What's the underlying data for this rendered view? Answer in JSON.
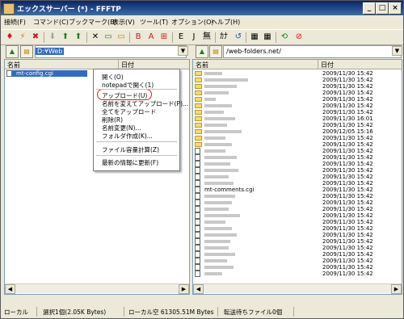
{
  "window": {
    "title": "エックスサーバー (*) - FFFTP",
    "minimize": "_",
    "maximize": "□",
    "close": "×"
  },
  "menu": [
    "接続(F)",
    "コマンド(C)",
    "ブックマーク(B)",
    "表示(V)",
    "ツール(T)",
    "オプション(O)",
    "ヘルプ(H)"
  ],
  "toolbar": {
    "icons": [
      "connect-icon",
      "quick-connect-icon",
      "disconnect-icon",
      "download-icon",
      "upload-icon",
      "mirror-upload-icon",
      "delete-icon",
      "rename-icon",
      "mkdir-icon",
      "binary-mode-icon",
      "ascii-mode-icon",
      "auto-mode-icon",
      "local-eucjp-icon",
      "local-jis-icon",
      "no-kana-icon",
      "kana-convert-icon",
      "refresh-icon",
      "list-view-icon",
      "detail-view-icon",
      "sync-folder-icon",
      "stop-icon"
    ],
    "labels": [
      "♦",
      "⚡",
      "✖",
      "⬇",
      "⬆",
      "⬆",
      "✕",
      "▭",
      "▭",
      "B",
      "A",
      "⊞",
      "E",
      "J",
      "無",
      "ｶﾅ",
      "↺",
      "▦",
      "▦",
      "⟲",
      "⊘"
    ]
  },
  "local": {
    "path": "D:¥Web",
    "col_name": "名前",
    "col_date": "日付",
    "files": [
      {
        "name": "mt-config.cgi",
        "type": "file"
      }
    ]
  },
  "remote": {
    "path": "/web-folders.net/",
    "col_name": "名前",
    "col_date": "日付",
    "entries": [
      {
        "name": "",
        "type": "folder",
        "date": "2009/11/30 15:42"
      },
      {
        "name": "",
        "type": "folder",
        "date": "2009/11/30 15:42"
      },
      {
        "name": "",
        "type": "folder",
        "date": "2009/11/30 15:42"
      },
      {
        "name": "",
        "type": "folder",
        "date": "2009/11/30 15:42"
      },
      {
        "name": "",
        "type": "folder",
        "date": "2009/11/30 15:42"
      },
      {
        "name": "",
        "type": "folder",
        "date": "2009/11/30 15:42"
      },
      {
        "name": "",
        "type": "folder",
        "date": "2009/11/30 15:42"
      },
      {
        "name": "",
        "type": "folder",
        "date": "2009/11/30 16:01"
      },
      {
        "name": "",
        "type": "folder",
        "date": "2009/11/30 15:42"
      },
      {
        "name": "",
        "type": "folder",
        "date": "2009/12/05 15:16"
      },
      {
        "name": "",
        "type": "folder",
        "date": "2009/11/30 15:42"
      },
      {
        "name": "",
        "type": "folder",
        "date": "2009/11/30 15:42"
      },
      {
        "name": "",
        "type": "file",
        "date": "2009/11/30 15:42"
      },
      {
        "name": "",
        "type": "file",
        "date": "2009/11/30 15:42"
      },
      {
        "name": "",
        "type": "file",
        "date": "2009/11/30 15:42"
      },
      {
        "name": "",
        "type": "file",
        "date": "2009/11/30 15:42"
      },
      {
        "name": "",
        "type": "file",
        "date": "2009/11/30 15:42"
      },
      {
        "name": "",
        "type": "file",
        "date": "2009/11/30 15:42"
      },
      {
        "name": "mt-comments.cgi",
        "type": "file",
        "date": "2009/11/30 15:42"
      },
      {
        "name": "",
        "type": "file",
        "date": "2009/11/30 15:42"
      },
      {
        "name": "",
        "type": "file",
        "date": "2009/11/30 15:42"
      },
      {
        "name": "",
        "type": "file",
        "date": "2009/11/30 15:42"
      },
      {
        "name": "",
        "type": "file",
        "date": "2009/11/30 15:42"
      },
      {
        "name": "",
        "type": "file",
        "date": "2009/11/30 15:42"
      },
      {
        "name": "",
        "type": "file",
        "date": "2009/11/30 15:42"
      },
      {
        "name": "",
        "type": "file",
        "date": "2009/11/30 15:42"
      },
      {
        "name": "",
        "type": "file",
        "date": "2009/11/30 15:42"
      },
      {
        "name": "",
        "type": "file",
        "date": "2009/11/30 15:42"
      },
      {
        "name": "",
        "type": "file",
        "date": "2009/11/30 15:42"
      },
      {
        "name": "",
        "type": "file",
        "date": "2009/11/30 15:42"
      },
      {
        "name": "",
        "type": "file",
        "date": "2009/11/30 15:42"
      },
      {
        "name": "",
        "type": "file",
        "date": "2009/11/30 15:42"
      }
    ]
  },
  "context_menu": {
    "items": [
      "開く(O)",
      "notepadで開く(1)",
      "アップロード(U)",
      "名前を変えてアップロード(P)...",
      "全てをアップロード",
      "削除(R)",
      "名前変更(N)...",
      "フォルダ作成(K)...",
      "ファイル容量計算(Z)",
      "最新の情報に更新(F)"
    ]
  },
  "status": {
    "local_label": "ローカル",
    "selection": "選択1個(2.05K Bytes)",
    "free_space": "ローカル空 61305.51M Bytes",
    "queue": "転送待ちファイル0個"
  },
  "colors": {
    "accent": "#316ac5",
    "highlight_ring": "#e02020",
    "titlebar": "#0a246a"
  }
}
